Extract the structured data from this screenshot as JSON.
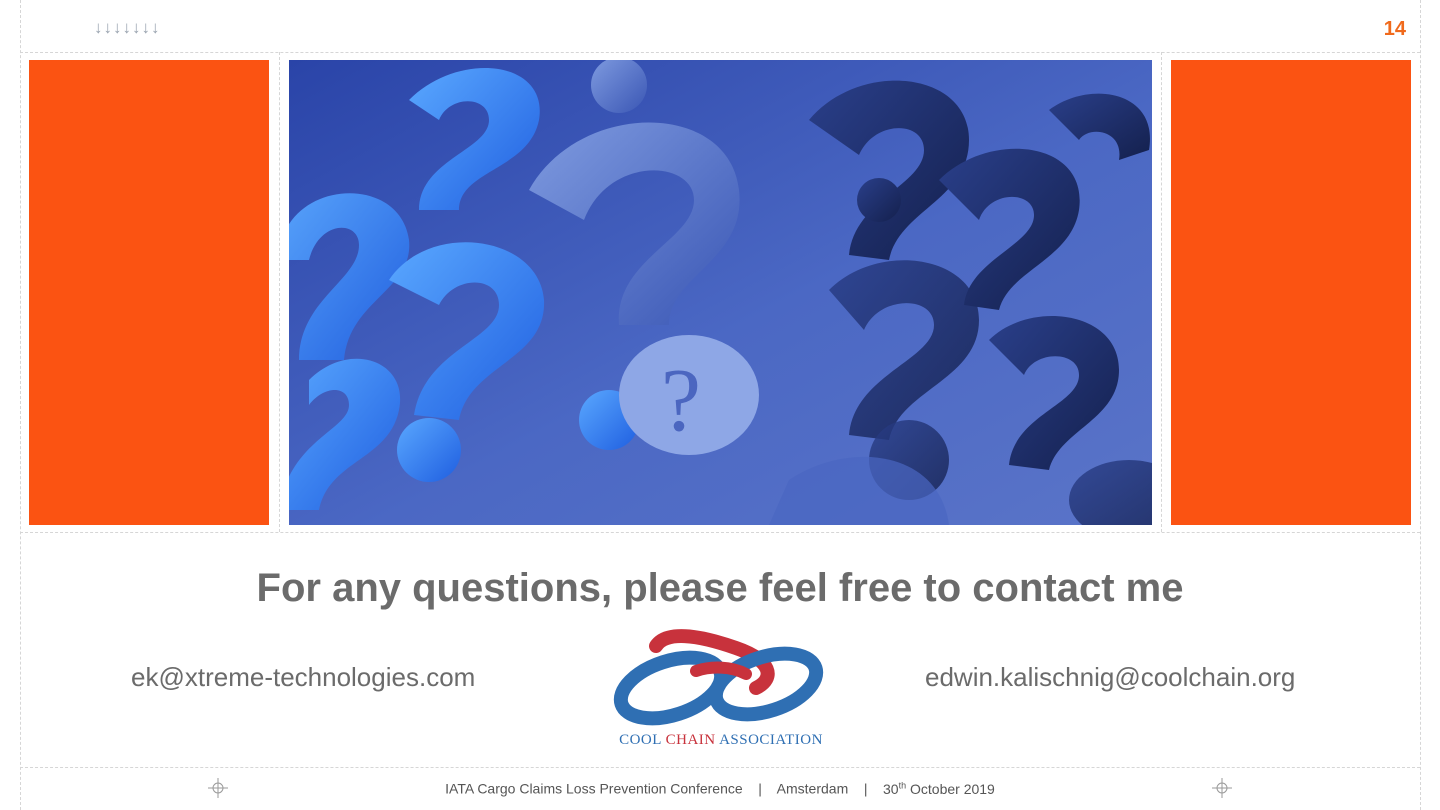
{
  "header": {
    "arrows": "↓↓↓↓↓↓↓",
    "page_number": "14"
  },
  "main": {
    "heading": "For any questions, please feel free to contact me",
    "email_left": "ek@xtreme-technologies.com",
    "email_right": "edwin.kalischnig@coolchain.org"
  },
  "logo": {
    "word_cool": "COOL",
    "word_chain": "CHAIN",
    "word_association": "ASSOCIATION"
  },
  "footer": {
    "conference": "IATA Cargo Claims Loss Prevention Conference",
    "separator": "|",
    "city": "Amsterdam",
    "date_day": "30",
    "date_suffix": "th",
    "date_rest": "October 2019"
  },
  "colors": {
    "accent_orange": "#fb5312",
    "page_number": "#f06a1c",
    "text_gray": "#6b6b6b",
    "logo_blue": "#2f6fb3",
    "logo_red": "#c8323c"
  },
  "icons": [
    "down-arrow-icon",
    "crosshair-icon",
    "question-mark-image"
  ]
}
